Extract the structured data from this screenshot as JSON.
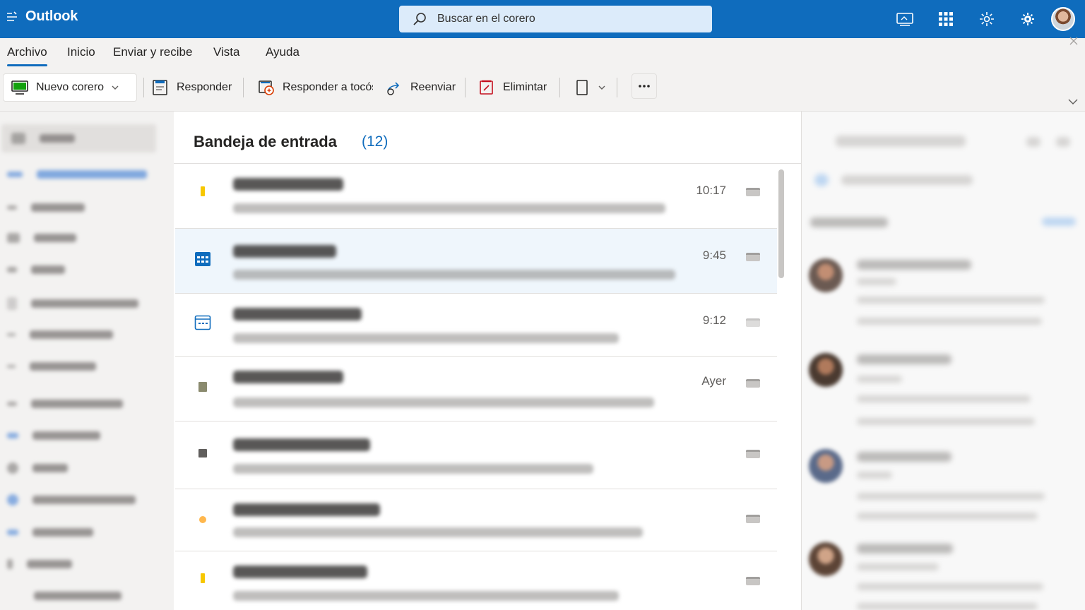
{
  "app": {
    "title": "Outlook"
  },
  "search": {
    "placeholder": "Buscar en el corero"
  },
  "menu": {
    "items": [
      "Archivo",
      "Inicio",
      "Enviar y recibe",
      "Vista",
      "Ayuda"
    ],
    "active": "Archivo"
  },
  "ribbon": {
    "new_mail": "Nuevo corero",
    "reply": "Responder",
    "reply_all": "Responder a tocós",
    "forward": "Reenviar",
    "delete": "Elimintar"
  },
  "inbox": {
    "title": "Bandeja de entrada",
    "count": "(12)",
    "messages": [
      {
        "time": "10:17",
        "icon": "flag-yellow-icon"
      },
      {
        "time": "9:45",
        "icon": "calendar-icon",
        "selected": true
      },
      {
        "time": "9:12",
        "icon": "calendar-outline-icon"
      },
      {
        "time": "Ayer",
        "icon": "note-icon"
      },
      {
        "time": "",
        "icon": "square-icon"
      },
      {
        "time": "",
        "icon": "dot-orange-icon"
      },
      {
        "time": "",
        "icon": "flag-yellow-icon"
      }
    ]
  },
  "colors": {
    "accent": "#0f6cbd",
    "search_bg": "#dcebfa",
    "selected_row": "#eff6fc"
  }
}
